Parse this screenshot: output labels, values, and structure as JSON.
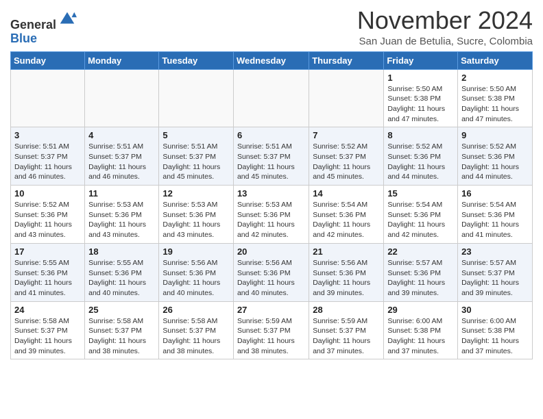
{
  "header": {
    "logo_line1": "General",
    "logo_line2": "Blue",
    "month_year": "November 2024",
    "location": "San Juan de Betulia, Sucre, Colombia"
  },
  "days_of_week": [
    "Sunday",
    "Monday",
    "Tuesday",
    "Wednesday",
    "Thursday",
    "Friday",
    "Saturday"
  ],
  "weeks": [
    [
      {
        "day": "",
        "info": ""
      },
      {
        "day": "",
        "info": ""
      },
      {
        "day": "",
        "info": ""
      },
      {
        "day": "",
        "info": ""
      },
      {
        "day": "",
        "info": ""
      },
      {
        "day": "1",
        "info": "Sunrise: 5:50 AM\nSunset: 5:38 PM\nDaylight: 11 hours and 47 minutes."
      },
      {
        "day": "2",
        "info": "Sunrise: 5:50 AM\nSunset: 5:38 PM\nDaylight: 11 hours and 47 minutes."
      }
    ],
    [
      {
        "day": "3",
        "info": "Sunrise: 5:51 AM\nSunset: 5:37 PM\nDaylight: 11 hours and 46 minutes."
      },
      {
        "day": "4",
        "info": "Sunrise: 5:51 AM\nSunset: 5:37 PM\nDaylight: 11 hours and 46 minutes."
      },
      {
        "day": "5",
        "info": "Sunrise: 5:51 AM\nSunset: 5:37 PM\nDaylight: 11 hours and 45 minutes."
      },
      {
        "day": "6",
        "info": "Sunrise: 5:51 AM\nSunset: 5:37 PM\nDaylight: 11 hours and 45 minutes."
      },
      {
        "day": "7",
        "info": "Sunrise: 5:52 AM\nSunset: 5:37 PM\nDaylight: 11 hours and 45 minutes."
      },
      {
        "day": "8",
        "info": "Sunrise: 5:52 AM\nSunset: 5:36 PM\nDaylight: 11 hours and 44 minutes."
      },
      {
        "day": "9",
        "info": "Sunrise: 5:52 AM\nSunset: 5:36 PM\nDaylight: 11 hours and 44 minutes."
      }
    ],
    [
      {
        "day": "10",
        "info": "Sunrise: 5:52 AM\nSunset: 5:36 PM\nDaylight: 11 hours and 43 minutes."
      },
      {
        "day": "11",
        "info": "Sunrise: 5:53 AM\nSunset: 5:36 PM\nDaylight: 11 hours and 43 minutes."
      },
      {
        "day": "12",
        "info": "Sunrise: 5:53 AM\nSunset: 5:36 PM\nDaylight: 11 hours and 43 minutes."
      },
      {
        "day": "13",
        "info": "Sunrise: 5:53 AM\nSunset: 5:36 PM\nDaylight: 11 hours and 42 minutes."
      },
      {
        "day": "14",
        "info": "Sunrise: 5:54 AM\nSunset: 5:36 PM\nDaylight: 11 hours and 42 minutes."
      },
      {
        "day": "15",
        "info": "Sunrise: 5:54 AM\nSunset: 5:36 PM\nDaylight: 11 hours and 42 minutes."
      },
      {
        "day": "16",
        "info": "Sunrise: 5:54 AM\nSunset: 5:36 PM\nDaylight: 11 hours and 41 minutes."
      }
    ],
    [
      {
        "day": "17",
        "info": "Sunrise: 5:55 AM\nSunset: 5:36 PM\nDaylight: 11 hours and 41 minutes."
      },
      {
        "day": "18",
        "info": "Sunrise: 5:55 AM\nSunset: 5:36 PM\nDaylight: 11 hours and 40 minutes."
      },
      {
        "day": "19",
        "info": "Sunrise: 5:56 AM\nSunset: 5:36 PM\nDaylight: 11 hours and 40 minutes."
      },
      {
        "day": "20",
        "info": "Sunrise: 5:56 AM\nSunset: 5:36 PM\nDaylight: 11 hours and 40 minutes."
      },
      {
        "day": "21",
        "info": "Sunrise: 5:56 AM\nSunset: 5:36 PM\nDaylight: 11 hours and 39 minutes."
      },
      {
        "day": "22",
        "info": "Sunrise: 5:57 AM\nSunset: 5:36 PM\nDaylight: 11 hours and 39 minutes."
      },
      {
        "day": "23",
        "info": "Sunrise: 5:57 AM\nSunset: 5:37 PM\nDaylight: 11 hours and 39 minutes."
      }
    ],
    [
      {
        "day": "24",
        "info": "Sunrise: 5:58 AM\nSunset: 5:37 PM\nDaylight: 11 hours and 39 minutes."
      },
      {
        "day": "25",
        "info": "Sunrise: 5:58 AM\nSunset: 5:37 PM\nDaylight: 11 hours and 38 minutes."
      },
      {
        "day": "26",
        "info": "Sunrise: 5:58 AM\nSunset: 5:37 PM\nDaylight: 11 hours and 38 minutes."
      },
      {
        "day": "27",
        "info": "Sunrise: 5:59 AM\nSunset: 5:37 PM\nDaylight: 11 hours and 38 minutes."
      },
      {
        "day": "28",
        "info": "Sunrise: 5:59 AM\nSunset: 5:37 PM\nDaylight: 11 hours and 37 minutes."
      },
      {
        "day": "29",
        "info": "Sunrise: 6:00 AM\nSunset: 5:38 PM\nDaylight: 11 hours and 37 minutes."
      },
      {
        "day": "30",
        "info": "Sunrise: 6:00 AM\nSunset: 5:38 PM\nDaylight: 11 hours and 37 minutes."
      }
    ]
  ]
}
